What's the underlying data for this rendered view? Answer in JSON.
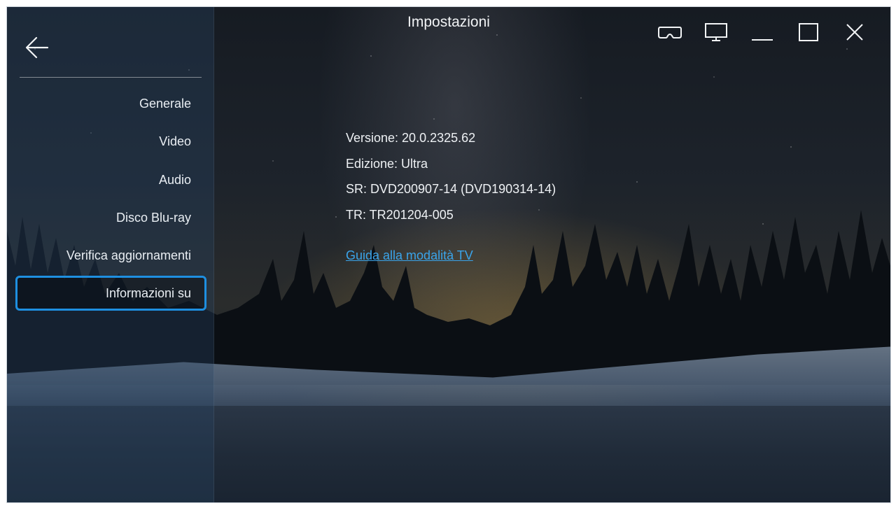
{
  "window": {
    "title": "Impostazioni"
  },
  "sidebar": {
    "items": [
      {
        "label": "Generale",
        "selected": false
      },
      {
        "label": "Video",
        "selected": false
      },
      {
        "label": "Audio",
        "selected": false
      },
      {
        "label": "Disco Blu-ray",
        "selected": false
      },
      {
        "label": "Verifica aggiornamenti",
        "selected": false
      },
      {
        "label": "Informazioni su",
        "selected": true
      }
    ]
  },
  "about": {
    "version": "Versione: 20.0.2325.62",
    "edition": "Edizione: Ultra",
    "sr": "SR: DVD200907-14 (DVD190314-14)",
    "tr": "TR: TR201204-005",
    "tv_guide_link": "Guida alla modalità TV"
  },
  "icons": {
    "back": "back-arrow-icon",
    "vr": "vr-headset-icon",
    "tv": "monitor-icon",
    "minimize": "minimize-icon",
    "maximize": "maximize-icon",
    "close": "close-icon"
  },
  "colors": {
    "accent": "#1e8fe0",
    "link": "#3aa4ea",
    "text": "#eef1f4"
  }
}
